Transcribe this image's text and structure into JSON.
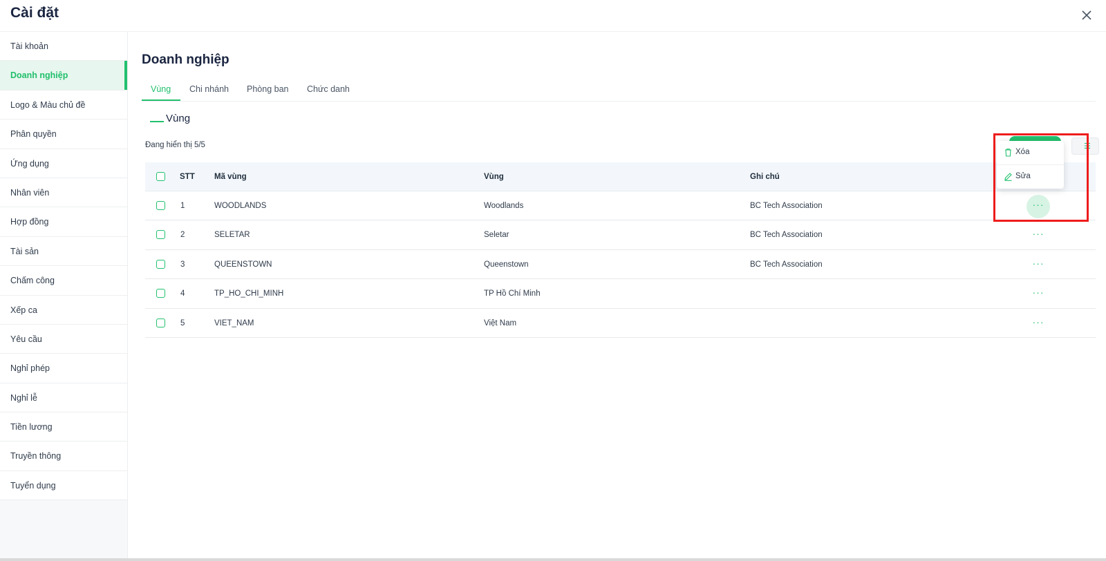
{
  "modal": {
    "title": "Cài đặt"
  },
  "sidebar": {
    "items": [
      {
        "label": "Tài khoản"
      },
      {
        "label": "Doanh nghiệp"
      },
      {
        "label": "Logo & Màu chủ đề"
      },
      {
        "label": "Phân quyền"
      },
      {
        "label": "Ứng dụng"
      },
      {
        "label": "Nhân viên"
      },
      {
        "label": "Hợp đồng"
      },
      {
        "label": "Tài sản"
      },
      {
        "label": "Chấm công"
      },
      {
        "label": "Xếp ca"
      },
      {
        "label": "Yêu cầu"
      },
      {
        "label": "Nghỉ phép"
      },
      {
        "label": "Nghỉ lễ"
      },
      {
        "label": "Tiền lương"
      },
      {
        "label": "Truyền thông"
      },
      {
        "label": "Tuyển dụng"
      }
    ],
    "active": "Doanh nghiệp"
  },
  "main": {
    "title": "Doanh nghiệp",
    "tabs": [
      {
        "label": "Vùng"
      },
      {
        "label": "Chi nhánh"
      },
      {
        "label": "Phòng ban"
      },
      {
        "label": "Chức danh"
      }
    ],
    "active_tab": "Vùng",
    "section_title": "Vùng",
    "count_text": "Đang hiển thị 5/5"
  },
  "table": {
    "headers": {
      "stt": "STT",
      "code": "Mã vùng",
      "region": "Vùng",
      "note": "Ghi chú"
    },
    "rows": [
      {
        "stt": "1",
        "code": "WOODLANDS",
        "region": "Woodlands",
        "note": "BC Tech Association"
      },
      {
        "stt": "2",
        "code": "SELETAR",
        "region": "Seletar",
        "note": "BC Tech Association"
      },
      {
        "stt": "3",
        "code": "QUEENSTOWN",
        "region": "Queenstown",
        "note": "BC Tech Association"
      },
      {
        "stt": "4",
        "code": "TP_HO_CHI_MINH",
        "region": "TP Hồ Chí Minh",
        "note": ""
      },
      {
        "stt": "5",
        "code": "VIET_NAM",
        "region": "Việt Nam",
        "note": ""
      }
    ],
    "row_action_glyph": "···"
  },
  "dropdown": {
    "items": [
      {
        "label": "Xóa",
        "icon": "trash-icon"
      },
      {
        "label": "Sửa",
        "icon": "pencil-icon"
      }
    ]
  },
  "colors": {
    "accent": "#22c06e",
    "highlight": "#ee1c1c",
    "title": "#1a2540"
  }
}
